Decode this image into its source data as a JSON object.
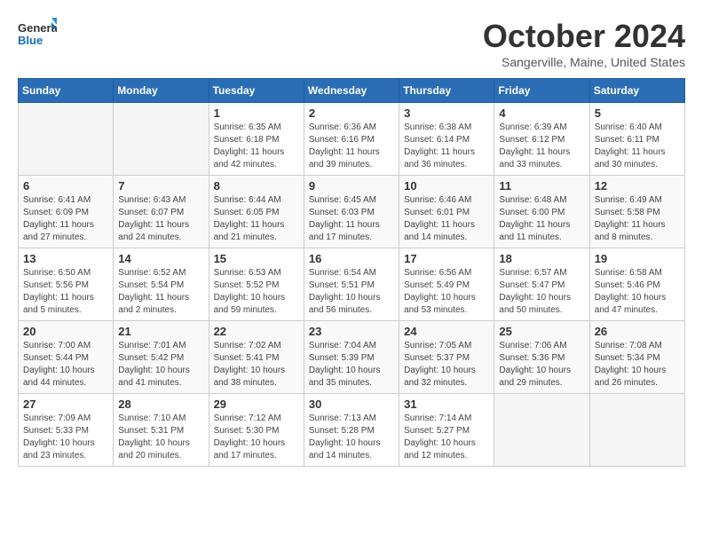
{
  "header": {
    "logo_general": "General",
    "logo_blue": "Blue",
    "month_title": "October 2024",
    "location": "Sangerville, Maine, United States"
  },
  "weekdays": [
    "Sunday",
    "Monday",
    "Tuesday",
    "Wednesday",
    "Thursday",
    "Friday",
    "Saturday"
  ],
  "weeks": [
    [
      {
        "day": "",
        "info": ""
      },
      {
        "day": "",
        "info": ""
      },
      {
        "day": "1",
        "info": "Sunrise: 6:35 AM\nSunset: 6:18 PM\nDaylight: 11 hours and 42 minutes."
      },
      {
        "day": "2",
        "info": "Sunrise: 6:36 AM\nSunset: 6:16 PM\nDaylight: 11 hours and 39 minutes."
      },
      {
        "day": "3",
        "info": "Sunrise: 6:38 AM\nSunset: 6:14 PM\nDaylight: 11 hours and 36 minutes."
      },
      {
        "day": "4",
        "info": "Sunrise: 6:39 AM\nSunset: 6:12 PM\nDaylight: 11 hours and 33 minutes."
      },
      {
        "day": "5",
        "info": "Sunrise: 6:40 AM\nSunset: 6:11 PM\nDaylight: 11 hours and 30 minutes."
      }
    ],
    [
      {
        "day": "6",
        "info": "Sunrise: 6:41 AM\nSunset: 6:09 PM\nDaylight: 11 hours and 27 minutes."
      },
      {
        "day": "7",
        "info": "Sunrise: 6:43 AM\nSunset: 6:07 PM\nDaylight: 11 hours and 24 minutes."
      },
      {
        "day": "8",
        "info": "Sunrise: 6:44 AM\nSunset: 6:05 PM\nDaylight: 11 hours and 21 minutes."
      },
      {
        "day": "9",
        "info": "Sunrise: 6:45 AM\nSunset: 6:03 PM\nDaylight: 11 hours and 17 minutes."
      },
      {
        "day": "10",
        "info": "Sunrise: 6:46 AM\nSunset: 6:01 PM\nDaylight: 11 hours and 14 minutes."
      },
      {
        "day": "11",
        "info": "Sunrise: 6:48 AM\nSunset: 6:00 PM\nDaylight: 11 hours and 11 minutes."
      },
      {
        "day": "12",
        "info": "Sunrise: 6:49 AM\nSunset: 5:58 PM\nDaylight: 11 hours and 8 minutes."
      }
    ],
    [
      {
        "day": "13",
        "info": "Sunrise: 6:50 AM\nSunset: 5:56 PM\nDaylight: 11 hours and 5 minutes."
      },
      {
        "day": "14",
        "info": "Sunrise: 6:52 AM\nSunset: 5:54 PM\nDaylight: 11 hours and 2 minutes."
      },
      {
        "day": "15",
        "info": "Sunrise: 6:53 AM\nSunset: 5:52 PM\nDaylight: 10 hours and 59 minutes."
      },
      {
        "day": "16",
        "info": "Sunrise: 6:54 AM\nSunset: 5:51 PM\nDaylight: 10 hours and 56 minutes."
      },
      {
        "day": "17",
        "info": "Sunrise: 6:56 AM\nSunset: 5:49 PM\nDaylight: 10 hours and 53 minutes."
      },
      {
        "day": "18",
        "info": "Sunrise: 6:57 AM\nSunset: 5:47 PM\nDaylight: 10 hours and 50 minutes."
      },
      {
        "day": "19",
        "info": "Sunrise: 6:58 AM\nSunset: 5:46 PM\nDaylight: 10 hours and 47 minutes."
      }
    ],
    [
      {
        "day": "20",
        "info": "Sunrise: 7:00 AM\nSunset: 5:44 PM\nDaylight: 10 hours and 44 minutes."
      },
      {
        "day": "21",
        "info": "Sunrise: 7:01 AM\nSunset: 5:42 PM\nDaylight: 10 hours and 41 minutes."
      },
      {
        "day": "22",
        "info": "Sunrise: 7:02 AM\nSunset: 5:41 PM\nDaylight: 10 hours and 38 minutes."
      },
      {
        "day": "23",
        "info": "Sunrise: 7:04 AM\nSunset: 5:39 PM\nDaylight: 10 hours and 35 minutes."
      },
      {
        "day": "24",
        "info": "Sunrise: 7:05 AM\nSunset: 5:37 PM\nDaylight: 10 hours and 32 minutes."
      },
      {
        "day": "25",
        "info": "Sunrise: 7:06 AM\nSunset: 5:36 PM\nDaylight: 10 hours and 29 minutes."
      },
      {
        "day": "26",
        "info": "Sunrise: 7:08 AM\nSunset: 5:34 PM\nDaylight: 10 hours and 26 minutes."
      }
    ],
    [
      {
        "day": "27",
        "info": "Sunrise: 7:09 AM\nSunset: 5:33 PM\nDaylight: 10 hours and 23 minutes."
      },
      {
        "day": "28",
        "info": "Sunrise: 7:10 AM\nSunset: 5:31 PM\nDaylight: 10 hours and 20 minutes."
      },
      {
        "day": "29",
        "info": "Sunrise: 7:12 AM\nSunset: 5:30 PM\nDaylight: 10 hours and 17 minutes."
      },
      {
        "day": "30",
        "info": "Sunrise: 7:13 AM\nSunset: 5:28 PM\nDaylight: 10 hours and 14 minutes."
      },
      {
        "day": "31",
        "info": "Sunrise: 7:14 AM\nSunset: 5:27 PM\nDaylight: 10 hours and 12 minutes."
      },
      {
        "day": "",
        "info": ""
      },
      {
        "day": "",
        "info": ""
      }
    ]
  ]
}
